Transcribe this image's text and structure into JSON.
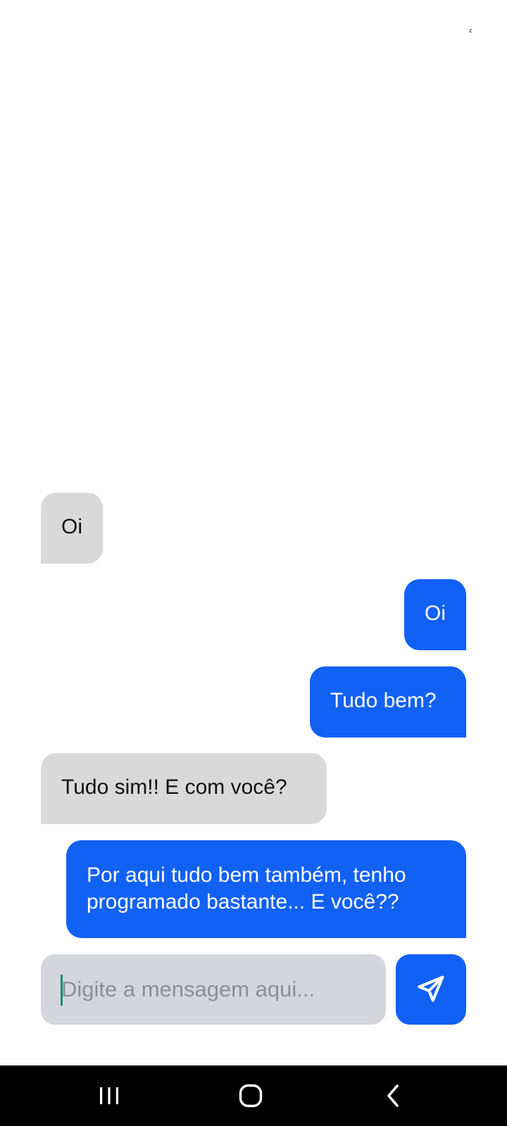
{
  "status_bar": {
    "indicator": "ᶻ"
  },
  "chat": {
    "messages": [
      {
        "direction": "received",
        "text": "Oi"
      },
      {
        "direction": "sent",
        "text": "Oi"
      },
      {
        "direction": "sent",
        "text": "Tudo bem?"
      },
      {
        "direction": "received",
        "text": "Tudo sim!! E com você?"
      },
      {
        "direction": "sent",
        "text": "Por aqui tudo bem também, tenho programado bastante... E você??"
      }
    ]
  },
  "composer": {
    "placeholder": "Digite a mensagem aqui...",
    "value": "",
    "send_icon": "send-icon"
  },
  "navigation": {
    "recents_icon": "recents-icon",
    "home_icon": "home-icon",
    "back_icon": "back-icon"
  },
  "colors": {
    "sent_bubble": "#1261f5",
    "received_bubble": "#d9d9d9",
    "input_background": "#d4d6db",
    "nav_background": "#000000"
  }
}
